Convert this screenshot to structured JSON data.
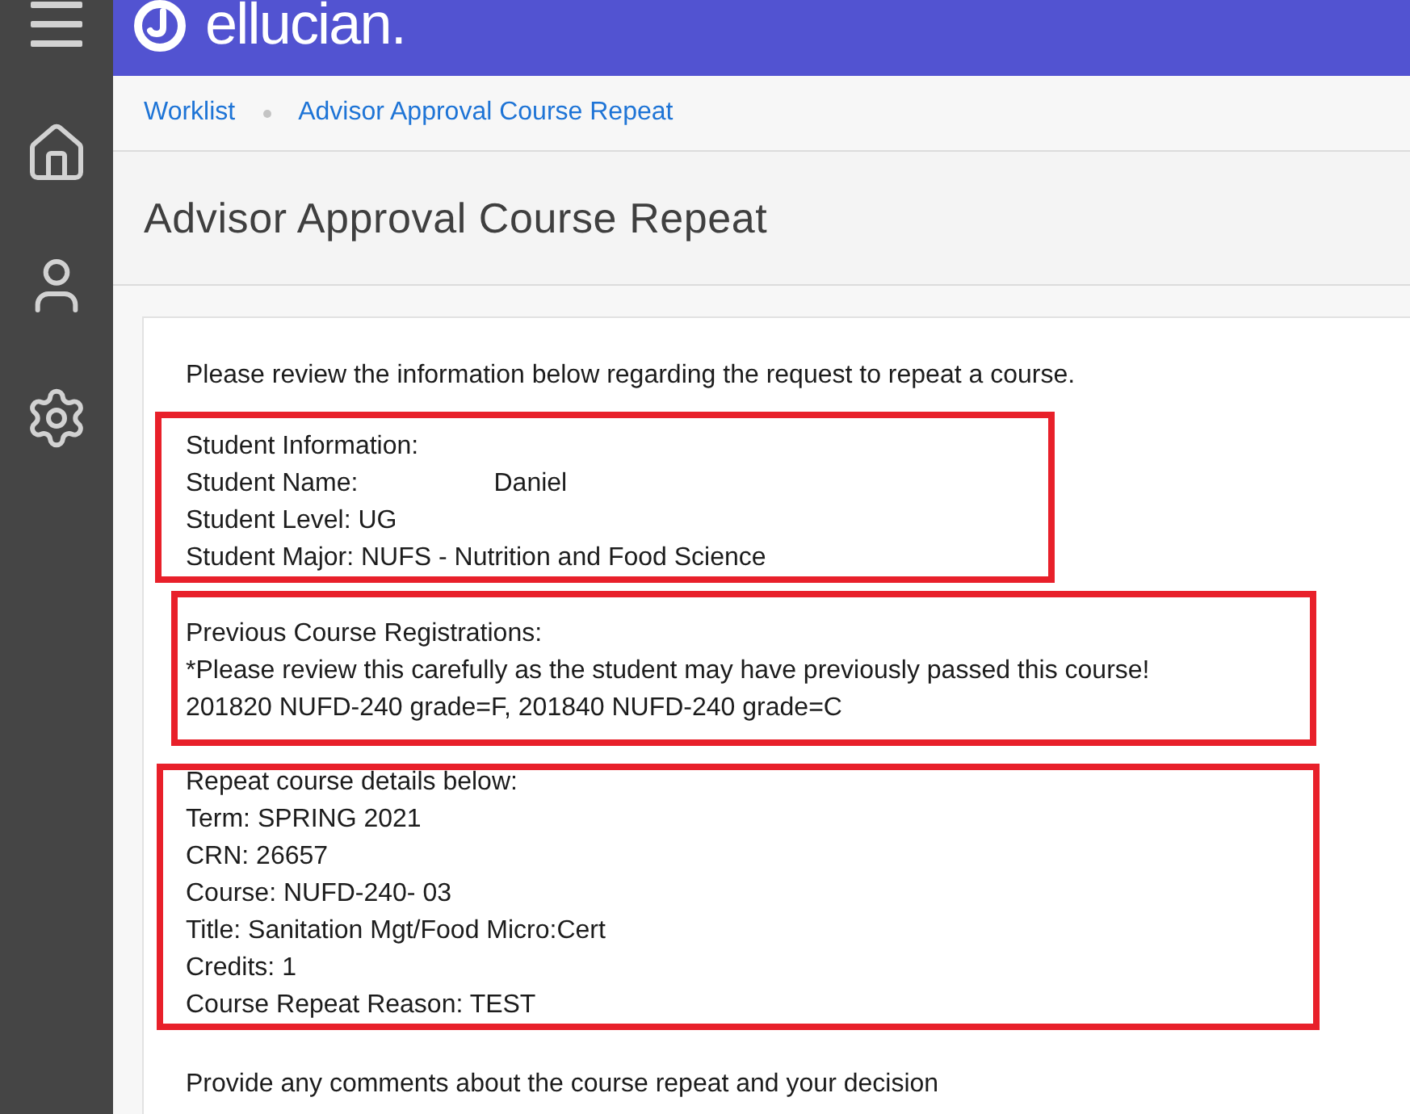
{
  "header": {
    "logo": "ellucian."
  },
  "breadcrumb": [
    {
      "label": "Worklist"
    },
    {
      "label": "Advisor Approval Course Repeat"
    }
  ],
  "page_title": "Advisor Approval Course Repeat",
  "content": {
    "intro": "Please review the information below regarding the request to repeat a course.",
    "sections": [
      {
        "highlighted": true,
        "lines": [
          {
            "text": "Student Information:"
          },
          {
            "text": "Student Name:",
            "value": "Daniel"
          },
          {
            "text": "Student Level: UG"
          },
          {
            "text": "Student Major: NUFS - Nutrition and Food Science"
          }
        ]
      },
      {
        "highlighted": true,
        "lines": [
          {
            "text": "Previous Course Registrations:"
          },
          {
            "text": "*Please review this carefully as the student may have previously passed this course!"
          },
          {
            "text": "201820 NUFD-240 grade=F, 201840 NUFD-240 grade=C"
          }
        ]
      },
      {
        "highlighted": true,
        "lines": [
          {
            "text": "Repeat course details below:"
          },
          {
            "text": "Term: SPRING 2021"
          },
          {
            "text": "CRN: 26657"
          },
          {
            "text": "Course: NUFD-240- 03"
          },
          {
            "text": "Title: Sanitation Mgt/Food Micro:Cert"
          },
          {
            "text": "Credits: 1"
          },
          {
            "text": "Course Repeat Reason: TEST"
          }
        ]
      }
    ],
    "prompt": "Provide any comments about the course repeat and your decision"
  }
}
